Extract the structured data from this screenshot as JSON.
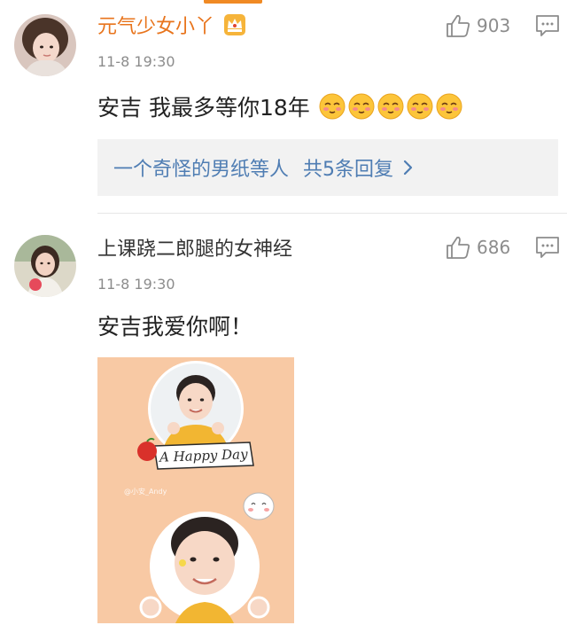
{
  "comments": [
    {
      "username": "元气少女小丫",
      "username_color": "#e8741c",
      "timestamp": "11-8 19:30",
      "text": "安吉 我最多等你18年",
      "emoji_count": 5,
      "likes": "903",
      "replies_summary": {
        "replier": "一个奇怪的男纸等人",
        "count_text": "共5条回复"
      }
    },
    {
      "username": "上课跷二郎腿的女神经",
      "username_color": "#333333",
      "timestamp": "11-8 19:30",
      "text": "安吉我爱你啊！",
      "likes": "686",
      "image": {
        "banner_text": "A Happy Day",
        "watermark": "@小安_Andy"
      }
    }
  ],
  "icons": {
    "like": "thumbs-up-icon",
    "reply": "comment-bubble-icon",
    "vip": "crown-badge-icon",
    "chevron": "chevron-right-icon",
    "emoji": "blushing-face-emoji"
  },
  "colors": {
    "accent": "#f08a24",
    "link": "#4f7db3",
    "meta": "#8c8c8c",
    "reply_bg": "#f2f2f2",
    "image_bg": "#f8c9a4"
  }
}
